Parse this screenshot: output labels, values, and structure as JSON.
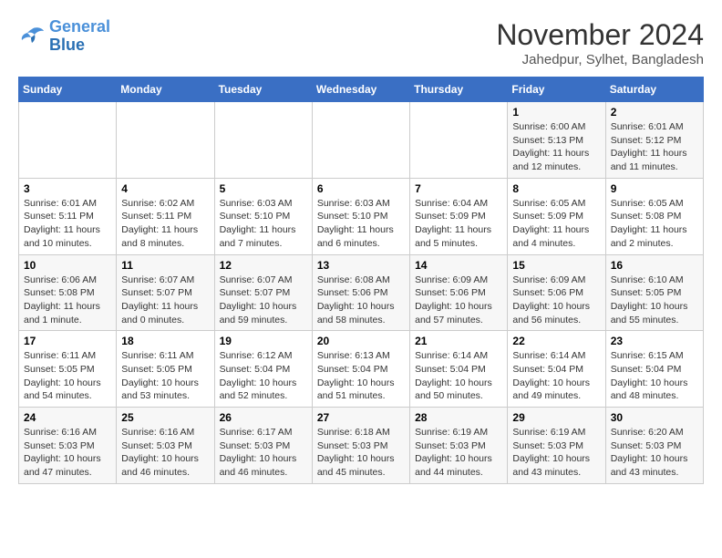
{
  "logo": {
    "line1": "General",
    "line2": "Blue"
  },
  "title": "November 2024",
  "subtitle": "Jahedpur, Sylhet, Bangladesh",
  "headers": [
    "Sunday",
    "Monday",
    "Tuesday",
    "Wednesday",
    "Thursday",
    "Friday",
    "Saturday"
  ],
  "weeks": [
    [
      {
        "day": "",
        "info": ""
      },
      {
        "day": "",
        "info": ""
      },
      {
        "day": "",
        "info": ""
      },
      {
        "day": "",
        "info": ""
      },
      {
        "day": "",
        "info": ""
      },
      {
        "day": "1",
        "info": "Sunrise: 6:00 AM\nSunset: 5:13 PM\nDaylight: 11 hours\nand 12 minutes."
      },
      {
        "day": "2",
        "info": "Sunrise: 6:01 AM\nSunset: 5:12 PM\nDaylight: 11 hours\nand 11 minutes."
      }
    ],
    [
      {
        "day": "3",
        "info": "Sunrise: 6:01 AM\nSunset: 5:11 PM\nDaylight: 11 hours\nand 10 minutes."
      },
      {
        "day": "4",
        "info": "Sunrise: 6:02 AM\nSunset: 5:11 PM\nDaylight: 11 hours\nand 8 minutes."
      },
      {
        "day": "5",
        "info": "Sunrise: 6:03 AM\nSunset: 5:10 PM\nDaylight: 11 hours\nand 7 minutes."
      },
      {
        "day": "6",
        "info": "Sunrise: 6:03 AM\nSunset: 5:10 PM\nDaylight: 11 hours\nand 6 minutes."
      },
      {
        "day": "7",
        "info": "Sunrise: 6:04 AM\nSunset: 5:09 PM\nDaylight: 11 hours\nand 5 minutes."
      },
      {
        "day": "8",
        "info": "Sunrise: 6:05 AM\nSunset: 5:09 PM\nDaylight: 11 hours\nand 4 minutes."
      },
      {
        "day": "9",
        "info": "Sunrise: 6:05 AM\nSunset: 5:08 PM\nDaylight: 11 hours\nand 2 minutes."
      }
    ],
    [
      {
        "day": "10",
        "info": "Sunrise: 6:06 AM\nSunset: 5:08 PM\nDaylight: 11 hours\nand 1 minute."
      },
      {
        "day": "11",
        "info": "Sunrise: 6:07 AM\nSunset: 5:07 PM\nDaylight: 11 hours\nand 0 minutes."
      },
      {
        "day": "12",
        "info": "Sunrise: 6:07 AM\nSunset: 5:07 PM\nDaylight: 10 hours\nand 59 minutes."
      },
      {
        "day": "13",
        "info": "Sunrise: 6:08 AM\nSunset: 5:06 PM\nDaylight: 10 hours\nand 58 minutes."
      },
      {
        "day": "14",
        "info": "Sunrise: 6:09 AM\nSunset: 5:06 PM\nDaylight: 10 hours\nand 57 minutes."
      },
      {
        "day": "15",
        "info": "Sunrise: 6:09 AM\nSunset: 5:06 PM\nDaylight: 10 hours\nand 56 minutes."
      },
      {
        "day": "16",
        "info": "Sunrise: 6:10 AM\nSunset: 5:05 PM\nDaylight: 10 hours\nand 55 minutes."
      }
    ],
    [
      {
        "day": "17",
        "info": "Sunrise: 6:11 AM\nSunset: 5:05 PM\nDaylight: 10 hours\nand 54 minutes."
      },
      {
        "day": "18",
        "info": "Sunrise: 6:11 AM\nSunset: 5:05 PM\nDaylight: 10 hours\nand 53 minutes."
      },
      {
        "day": "19",
        "info": "Sunrise: 6:12 AM\nSunset: 5:04 PM\nDaylight: 10 hours\nand 52 minutes."
      },
      {
        "day": "20",
        "info": "Sunrise: 6:13 AM\nSunset: 5:04 PM\nDaylight: 10 hours\nand 51 minutes."
      },
      {
        "day": "21",
        "info": "Sunrise: 6:14 AM\nSunset: 5:04 PM\nDaylight: 10 hours\nand 50 minutes."
      },
      {
        "day": "22",
        "info": "Sunrise: 6:14 AM\nSunset: 5:04 PM\nDaylight: 10 hours\nand 49 minutes."
      },
      {
        "day": "23",
        "info": "Sunrise: 6:15 AM\nSunset: 5:04 PM\nDaylight: 10 hours\nand 48 minutes."
      }
    ],
    [
      {
        "day": "24",
        "info": "Sunrise: 6:16 AM\nSunset: 5:03 PM\nDaylight: 10 hours\nand 47 minutes."
      },
      {
        "day": "25",
        "info": "Sunrise: 6:16 AM\nSunset: 5:03 PM\nDaylight: 10 hours\nand 46 minutes."
      },
      {
        "day": "26",
        "info": "Sunrise: 6:17 AM\nSunset: 5:03 PM\nDaylight: 10 hours\nand 46 minutes."
      },
      {
        "day": "27",
        "info": "Sunrise: 6:18 AM\nSunset: 5:03 PM\nDaylight: 10 hours\nand 45 minutes."
      },
      {
        "day": "28",
        "info": "Sunrise: 6:19 AM\nSunset: 5:03 PM\nDaylight: 10 hours\nand 44 minutes."
      },
      {
        "day": "29",
        "info": "Sunrise: 6:19 AM\nSunset: 5:03 PM\nDaylight: 10 hours\nand 43 minutes."
      },
      {
        "day": "30",
        "info": "Sunrise: 6:20 AM\nSunset: 5:03 PM\nDaylight: 10 hours\nand 43 minutes."
      }
    ]
  ]
}
